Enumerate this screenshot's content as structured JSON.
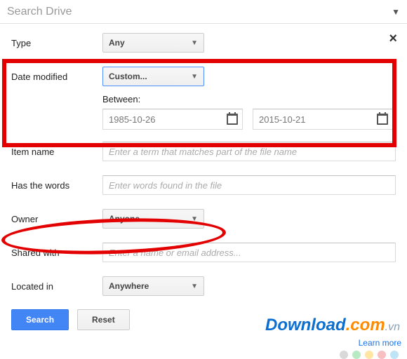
{
  "searchbar": {
    "placeholder": "Search Drive"
  },
  "form": {
    "type": {
      "label": "Type",
      "value": "Any"
    },
    "date_modified": {
      "label": "Date modified",
      "value": "Custom...",
      "between_label": "Between:",
      "from": "1985-10-26",
      "to": "2015-10-21"
    },
    "item_name": {
      "label": "Item name",
      "placeholder": "Enter a term that matches part of the file name"
    },
    "has_words": {
      "label": "Has the words",
      "placeholder": "Enter words found in the file"
    },
    "owner": {
      "label": "Owner",
      "value": "Anyone"
    },
    "shared_with": {
      "label": "Shared with",
      "placeholder": "Enter a name or email address..."
    },
    "located_in": {
      "label": "Located in",
      "value": "Anywhere"
    }
  },
  "buttons": {
    "search": "Search",
    "reset": "Reset"
  },
  "footer": {
    "learn_more": "Learn more",
    "wm_a": "Download",
    "wm_b": ".com",
    "wm_c": ".vn"
  },
  "annotations": {
    "highlight_color": "#e30000"
  }
}
